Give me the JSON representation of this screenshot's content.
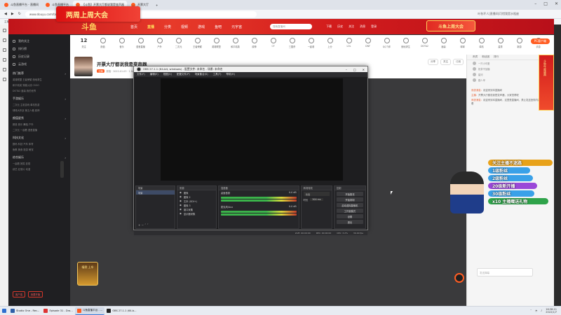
{
  "browser": {
    "tabs": [
      {
        "label": "斗鱼直播平台 - 直播间",
        "color": "#ff5d23"
      },
      {
        "label": "斗鱼直播平台",
        "color": "#ff5d23"
      },
      {
        "label": "【斗鱼】开票大厅都说我是变声器",
        "color": "#ff5d23",
        "active": true
      },
      {
        "label": "开票大厅",
        "color": "#ff5d23"
      }
    ],
    "url": "www.douyu.com/topic/lcdtj?rid=74960",
    "right_text": "叶秋坏人|直播间|可惜我是水瓶座",
    "bookmarks": [
      "主播开播了",
      "直播中心",
      "斗鱼",
      "斗鱼中心",
      "斗鱼导航",
      "弹幕助手"
    ]
  },
  "banner": {
    "logo": "斗鱼",
    "promo_left": "两周上周大会",
    "promo_right": "斗鱼上周大会",
    "nav": [
      "首页",
      "直播",
      "分类",
      "视频",
      "游戏",
      "鱼吧",
      "元宇宙"
    ],
    "nav_active": "直播",
    "search_placeholder": "搜索直播间",
    "right": [
      "下载",
      "历史",
      "关注",
      "消息",
      "登录"
    ]
  },
  "categories": {
    "count": "12",
    "count_label": "关注",
    "items": [
      "颜值",
      "音乐",
      "语音直播",
      "户外",
      "二次元",
      "王者荣耀",
      "英雄联盟",
      "和平精英",
      "原神",
      "CF",
      "三国杀",
      "一起看",
      "上分",
      "LOL",
      "DNF",
      "QQ飞车",
      "绝地求生",
      "DOTA2",
      "魔兽",
      "球球",
      "单机",
      "星秀",
      "新游",
      "手游"
    ],
    "pc_button": "PC客户端"
  },
  "sidebar": {
    "items": [
      "我的关注",
      "排行榜",
      "历史记录",
      "云游戏"
    ],
    "sections": [
      {
        "title": "热门推荐",
        "rows": [
          "英雄联盟 王者荣耀 绝地求生",
          "和平精英 穿越火线 CSGO",
          "DOTA2 魔兽 我的世界"
        ]
      },
      {
        "title": "手游娱乐",
        "rows": [
          "二次元 主机游戏 单机热游",
          "球球大作战 第五人格 原神"
        ]
      },
      {
        "title": "颜值星秀",
        "rows": [
          "颜值 音乐 舞蹈 户外",
          "二次元 一起看 语音直播"
        ]
      },
      {
        "title": "科技文化",
        "rows": [
          "数码 科技 汽车 体育",
          "鱼教 美食 旅游 萌宠"
        ]
      },
      {
        "title": "综合娱乐",
        "rows": [
          "一起看 搞笑 影视",
          "综艺 纪录片 动漫"
        ]
      }
    ],
    "btn_left": "客户端",
    "btn_right": "我要开播"
  },
  "room": {
    "title": "开票大厅都说我是变声器",
    "tag": "主播",
    "meta": "颜值 · 2022-01-03 · 1.8w",
    "buttons": [
      "分享",
      "关注",
      "订阅"
    ]
  },
  "obs": {
    "title": "OBS 27.1.1 (64-bit, windows) - 配置文件: 未命名 - 场景: 未命名",
    "menu": [
      "文件(F)",
      "编辑(E)",
      "视图(V)",
      "配置文件(P)",
      "场景集合(S)",
      "工具(T)",
      "帮助(H)"
    ],
    "docks": {
      "scenes": {
        "title": "场景",
        "items": [
          "场景"
        ]
      },
      "sources": {
        "title": "来源",
        "items": [
          "图像",
          "图像 2",
          "文本 (GDI+)",
          "图像 3",
          "窗口采集",
          "显示器采集"
        ]
      },
      "mixer": {
        "title": "混音器",
        "items": [
          "桌面音频",
          "麦克风/Aux"
        ],
        "levels": [
          "0.0 dB",
          "0.0 dB"
        ]
      },
      "transitions": {
        "title": "转场特效",
        "type": "淡出",
        "duration_label": "时长",
        "duration": "300 ms"
      },
      "controls": {
        "title": "控制",
        "buttons": [
          "开始推流",
          "开始录制",
          "启动虚拟摄像机",
          "工作室模式",
          "设置",
          "退出"
        ]
      }
    },
    "status": [
      "LIVE: 00:00:00",
      "REC: 00:00:00",
      "CPU: 3.2%",
      "30.00 fps"
    ]
  },
  "chat": {
    "rank_tabs": [
      "贵宾",
      "粉丝团",
      "排行"
    ],
    "ranks": [
      "一只小可爱",
      "奶茶不加糖",
      "星河",
      "路人甲"
    ],
    "messages": [
      {
        "name": "系统消息：",
        "text": "欢迎来到本直播间"
      },
      {
        "name": "主播：",
        "text": "开票大厅都说我是变声器，大家觉得呢"
      },
      {
        "name": "系统消息：",
        "text": "欢迎来到本直播间，这里是直播间，禁止发送违规内容，文明观看"
      }
    ],
    "gift_lines": [
      "关注主播不迷路",
      "1级粉丝",
      "2级粉丝",
      "10级粉丝",
      "20级新开播",
      "30级粉丝",
      "40级粉丝",
      "x10 主播赠送礼物"
    ],
    "input_placeholder": "发送弹幕",
    "red_ribbon": "斗鱼年度盛典"
  },
  "gift_box": "福袋 上车",
  "taskbar": {
    "items": [
      {
        "label": "Studio One - Rec...",
        "color": "#2e5fa8"
      },
      {
        "label": "Episode 31 - Dra...",
        "color": "#d33"
      },
      {
        "label": "斗鱼直播平台 - ...",
        "color": "#ff5d23",
        "active": true
      },
      {
        "label": "OBS 27.1.1 (64-b...",
        "color": "#222"
      }
    ],
    "time": "16:38:11",
    "date": "2022/1/7"
  }
}
